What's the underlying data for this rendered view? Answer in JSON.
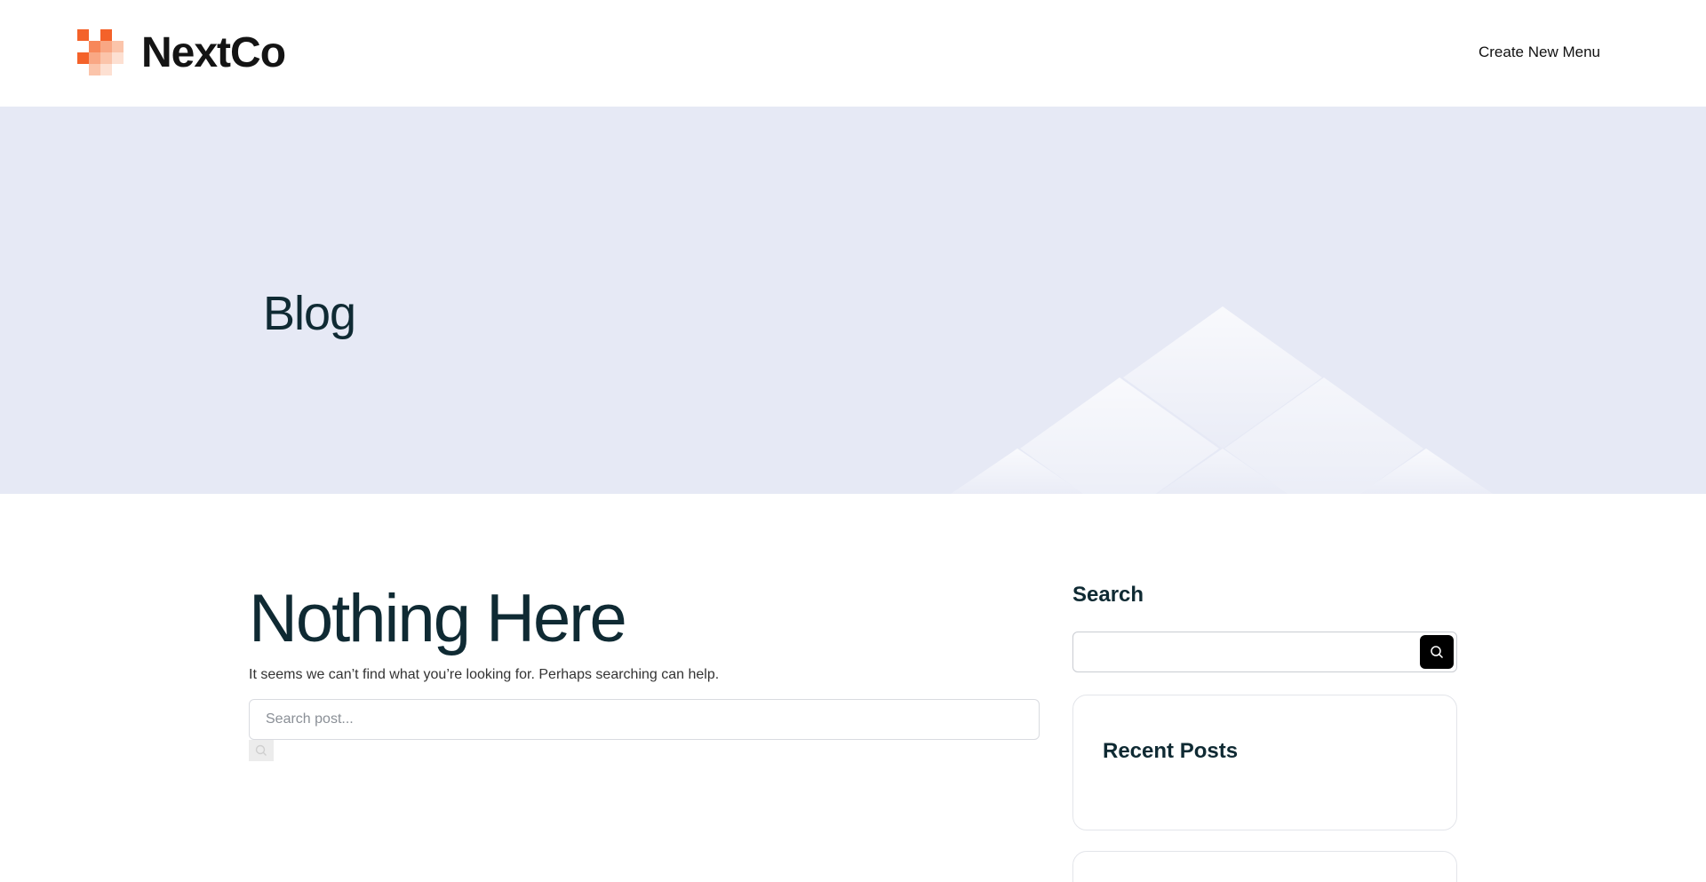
{
  "header": {
    "brand": "NextCo",
    "nav_link": "Create New Menu",
    "logo_colors": [
      "#f4622a",
      "#f7875a",
      "#f9a784",
      "#fbc4aa",
      "#fde0d2"
    ]
  },
  "hero": {
    "title": "Blog",
    "background": "#e6e9f5"
  },
  "main": {
    "title": "Nothing Here",
    "message": "It seems we can’t find what you’re looking for. Perhaps searching can help.",
    "search_placeholder": "Search post..."
  },
  "sidebar": {
    "search_title": "Search",
    "search_value": "",
    "recent_posts_title": "Recent Posts"
  },
  "icons": {
    "search_button": "search-icon",
    "main_search_button": "search-icon"
  }
}
